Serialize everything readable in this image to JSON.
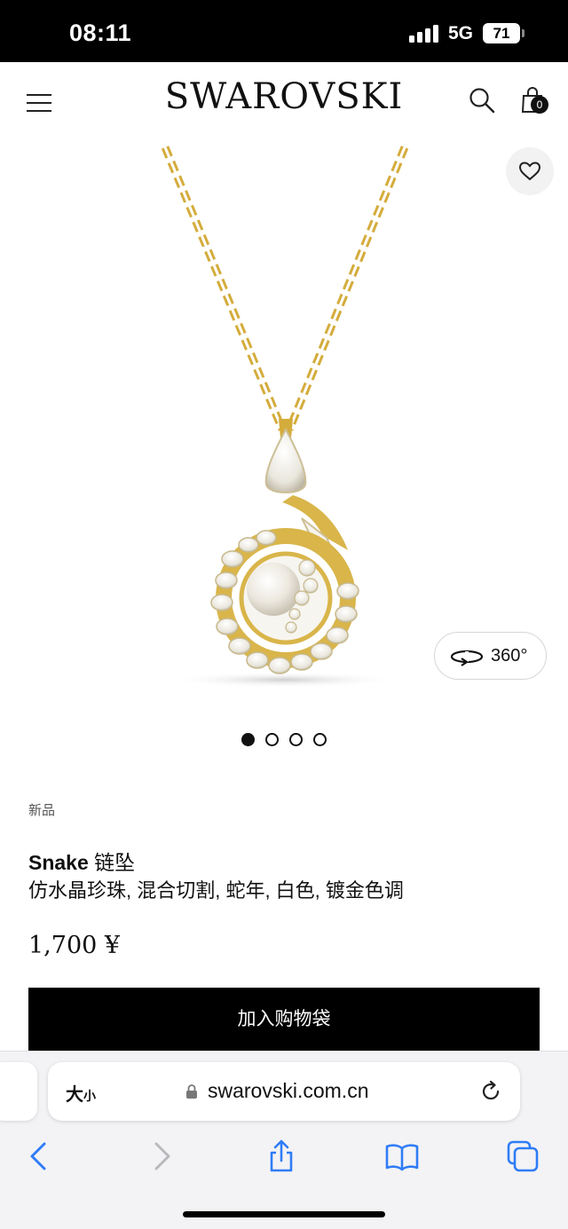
{
  "status_bar": {
    "time": "08:11",
    "network": "5G",
    "battery": "71"
  },
  "header": {
    "brand": "SWAROVSKI",
    "bag_count": "0"
  },
  "product": {
    "view_360_label": "360°",
    "badge": "新品",
    "name": "Snake",
    "type": "链坠",
    "description": "仿水晶珍珠, 混合切割, 蛇年, 白色, 镀金色调",
    "price": "1,700 ¥",
    "add_to_bag_label": "加入购物袋",
    "gallery": {
      "total": 4,
      "active_index": 0
    }
  },
  "browser": {
    "text_size_label": "大",
    "text_size_small": "小",
    "url": "swarovski.com.cn"
  },
  "icons": [
    "menu-icon",
    "search-icon",
    "shopping-bag-icon",
    "heart-icon",
    "rotate-360-icon",
    "lock-icon",
    "reload-icon",
    "back-icon",
    "forward-icon",
    "share-icon",
    "bookmarks-icon",
    "tabs-icon"
  ],
  "colors": {
    "gold": "#d9b54a",
    "button_black": "#000000",
    "accent_blue": "#2f7cf6"
  }
}
